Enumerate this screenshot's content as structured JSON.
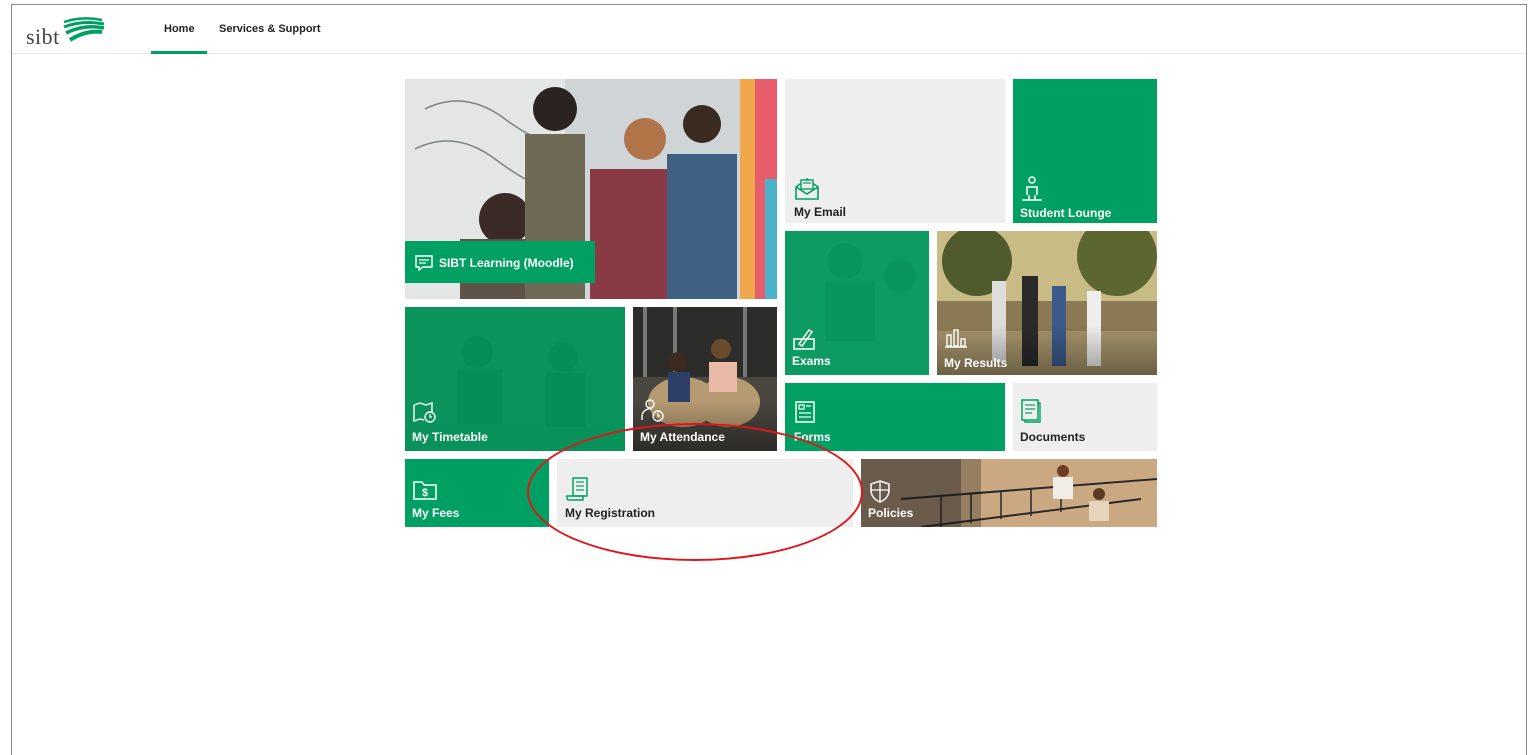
{
  "header": {
    "logo_text": "sibt",
    "nav": [
      {
        "label": "Home",
        "active": true
      },
      {
        "label": "Services & Support",
        "active": false
      }
    ]
  },
  "tiles": {
    "moodle": {
      "label": "SIBT Learning (Moodle)",
      "icon": "chat-icon"
    },
    "email": {
      "label": "My Email",
      "icon": "envelope-icon"
    },
    "lounge": {
      "label": "Student Lounge",
      "icon": "person-icon"
    },
    "exams": {
      "label": "Exams",
      "icon": "pen-paper-icon"
    },
    "results": {
      "label": "My Results",
      "icon": "bar-chart-icon"
    },
    "timetable": {
      "label": "My Timetable",
      "icon": "calendar-clock-icon"
    },
    "attendance": {
      "label": "My Attendance",
      "icon": "person-clock-icon"
    },
    "forms": {
      "label": "Forms",
      "icon": "form-icon"
    },
    "documents": {
      "label": "Documents",
      "icon": "document-icon"
    },
    "fees": {
      "label": "My Fees",
      "icon": "dollar-folder-icon"
    },
    "registration": {
      "label": "My Registration",
      "icon": "receipt-icon"
    },
    "policies": {
      "label": "Policies",
      "icon": "shield-icon"
    }
  },
  "colors": {
    "accent": "#00a062",
    "tile_gray": "#efeeee",
    "annotation": "#e0151b"
  }
}
